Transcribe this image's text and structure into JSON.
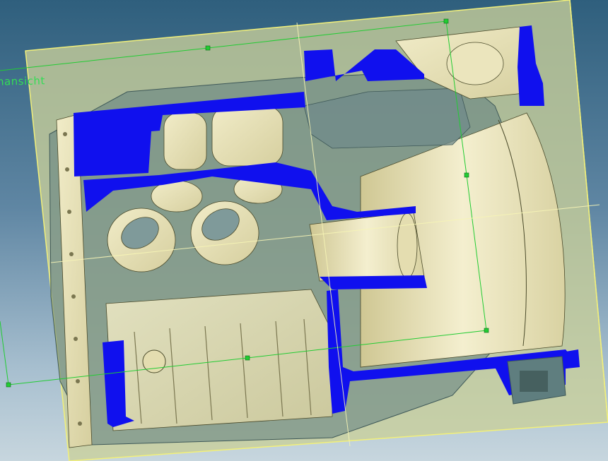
{
  "viewport": {
    "background_top": "#2f5f7d",
    "background_bottom": "#c7d6de",
    "view_label": "hansicht"
  },
  "colors": {
    "cut_surface": "#1010ee",
    "body_metal": "#e9e3b8",
    "ghost_plane": "#c9cf9a",
    "plane_border": "#f2f07a",
    "section_line": "#22cc33",
    "edge_line": "#4a4a2a"
  },
  "model": {
    "type": "cad-section-view",
    "part": "engine-block-cutaway"
  }
}
